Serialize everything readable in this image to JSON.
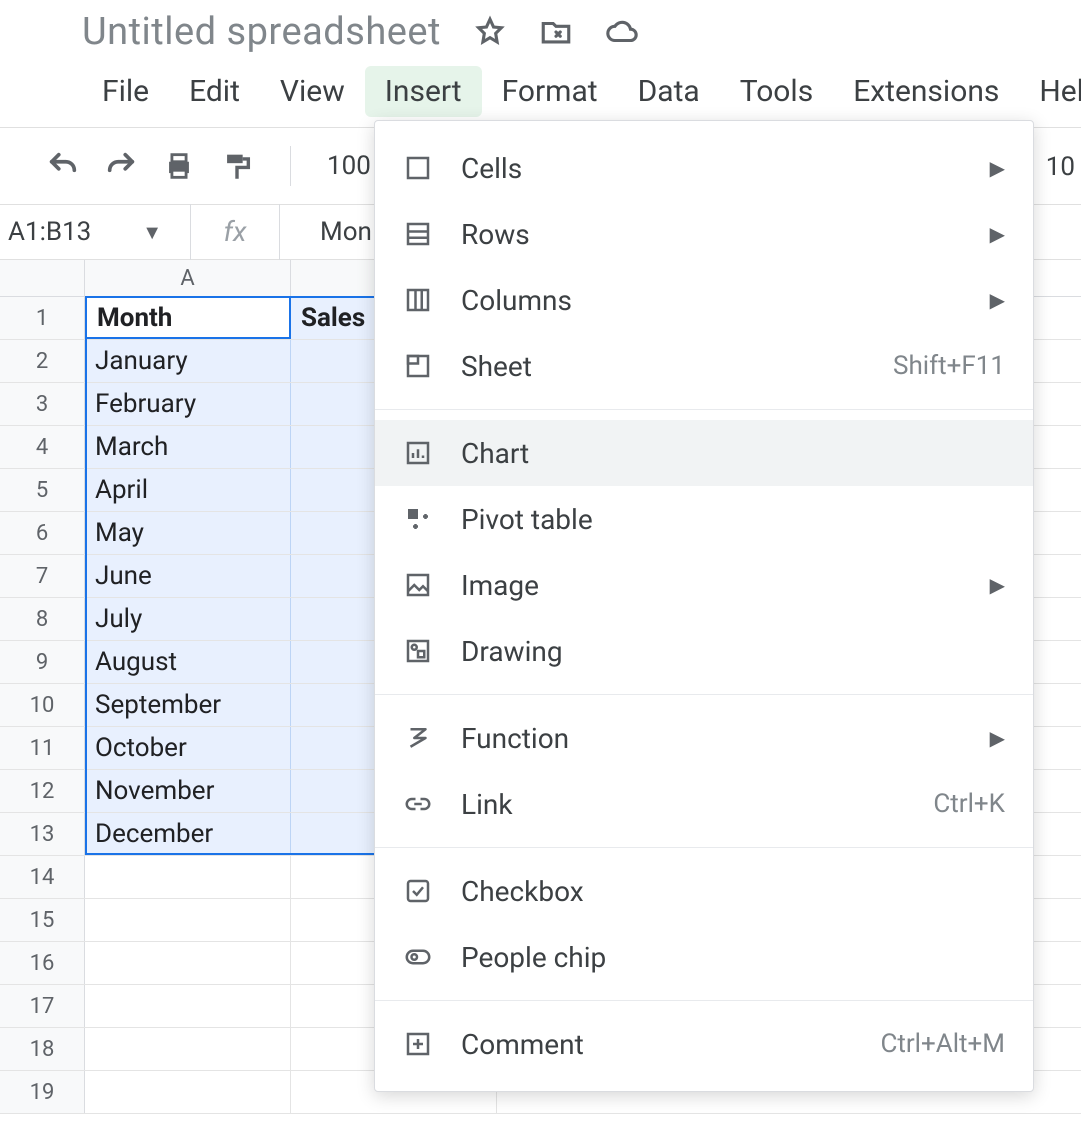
{
  "doc": {
    "title": "Untitled spreadsheet"
  },
  "menubar": {
    "file": "File",
    "edit": "Edit",
    "view": "View",
    "insert": "Insert",
    "format": "Format",
    "data": "Data",
    "tools": "Tools",
    "extensions": "Extensions",
    "help": "Help"
  },
  "toolbar": {
    "zoom": "100",
    "zoom_right": "10"
  },
  "formulabar": {
    "namebox": "A1:B13",
    "fx": "fx",
    "value": "Mon"
  },
  "columns": {
    "A": "A"
  },
  "rows": {
    "headers": [
      "1",
      "2",
      "3",
      "4",
      "5",
      "6",
      "7",
      "8",
      "9",
      "10",
      "11",
      "12",
      "13",
      "14",
      "15",
      "16",
      "17",
      "18",
      "19"
    ],
    "A": [
      "Month",
      "January",
      "February",
      "March",
      "April",
      "May",
      "June",
      "July",
      "August",
      "September",
      "October",
      "November",
      "December",
      "",
      "",
      "",
      "",
      "",
      ""
    ],
    "B": [
      "Sales",
      "",
      "",
      "",
      "",
      "",
      "",
      "",
      "",
      "",
      "",
      "",
      "",
      "",
      "",
      "",
      "",
      "",
      ""
    ]
  },
  "active_cell_label": "Month",
  "menu": {
    "cells": "Cells",
    "rows": "Rows",
    "columns": "Columns",
    "sheet": "Sheet",
    "sheet_kbd": "Shift+F11",
    "chart": "Chart",
    "pivot": "Pivot table",
    "image": "Image",
    "drawing": "Drawing",
    "function": "Function",
    "link": "Link",
    "link_kbd": "Ctrl+K",
    "checkbox": "Checkbox",
    "peoplechip": "People chip",
    "comment": "Comment",
    "comment_kbd": "Ctrl+Alt+M"
  }
}
